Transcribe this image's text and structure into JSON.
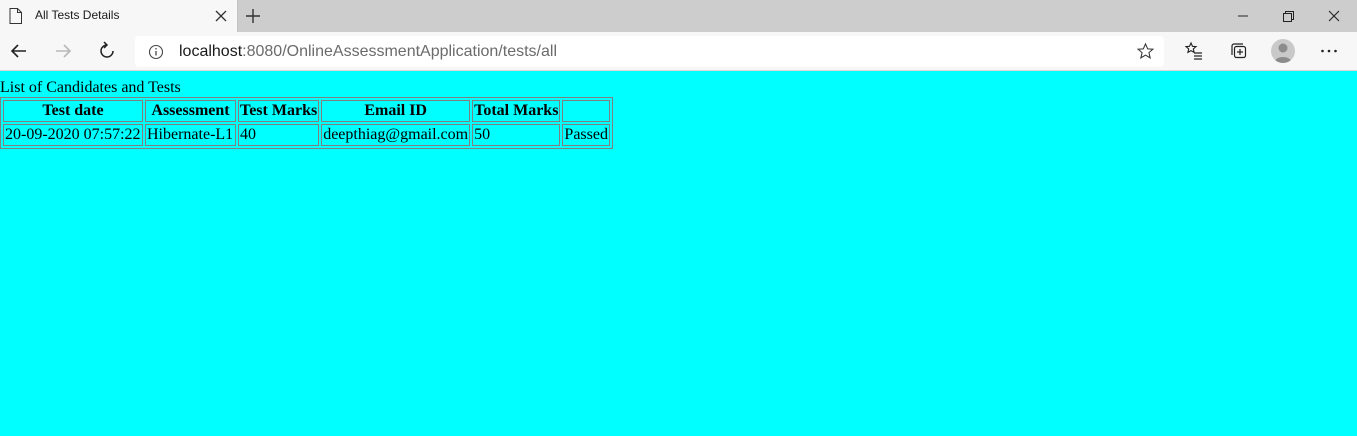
{
  "browser": {
    "tab": {
      "title": "All Tests Details"
    },
    "address": {
      "host": "localhost",
      "path": ":8080/OnlineAssessmentApplication/tests/all"
    },
    "icons": {
      "tab_page": "page-icon",
      "tab_close": "close-icon",
      "new_tab": "plus-icon",
      "back": "arrow-left-icon",
      "forward": "arrow-right-icon",
      "refresh": "refresh-icon",
      "site_info": "info-icon",
      "favorite": "star-icon",
      "favorites_list": "favorites-icon",
      "collections": "collections-icon",
      "profile": "avatar-icon",
      "menu": "ellipsis-icon"
    }
  },
  "page": {
    "background_color": "#00ffff",
    "title": "List of Candidates and Tests",
    "table": {
      "headers": [
        "Test date",
        "Assessment",
        "Test Marks",
        "Email ID",
        "Total Marks",
        ""
      ],
      "rows": [
        [
          "20-09-2020 07:57:22",
          "Hibernate-L1",
          "40",
          "deepthiag@gmail.com",
          "50",
          "Passed"
        ]
      ]
    }
  }
}
